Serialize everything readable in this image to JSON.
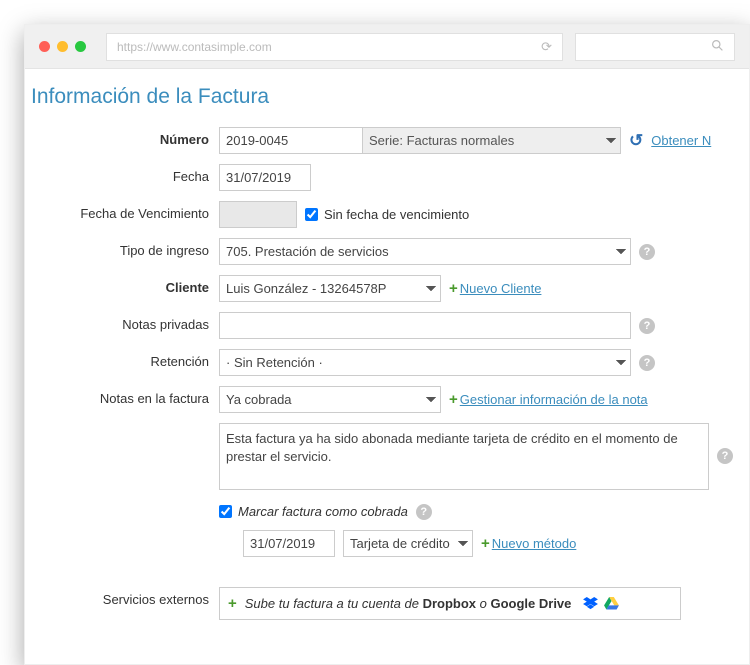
{
  "browser": {
    "url": "https://www.contasimple.com"
  },
  "title": "Información de la Factura",
  "labels": {
    "numero": "Número",
    "fecha": "Fecha",
    "fecha_venc": "Fecha de Vencimiento",
    "tipo_ingreso": "Tipo de ingreso",
    "cliente": "Cliente",
    "notas_priv": "Notas privadas",
    "retencion": "Retención",
    "notas_fact": "Notas en la factura",
    "serv_ext": "Servicios externos"
  },
  "numero": {
    "value": "2019-0045",
    "serie": "Serie: Facturas normales",
    "obtener": "Obtener N"
  },
  "fecha": {
    "value": "31/07/2019"
  },
  "fecha_venc": {
    "value": "",
    "sin_checked": true,
    "sin_label": "Sin fecha de vencimiento"
  },
  "tipo_ingreso": {
    "value": "705. Prestación de servicios"
  },
  "cliente": {
    "value": "Luis González - 13264578P",
    "nuevo": "Nuevo Cliente"
  },
  "notas_priv": {
    "value": ""
  },
  "retencion": {
    "value": "· Sin Retención ·"
  },
  "notas_fact": {
    "select": "Ya cobrada",
    "gestionar": "Gestionar información de la nota",
    "text": "Esta factura ya ha sido abonada mediante tarjeta de crédito en el momento de prestar el servicio."
  },
  "cobrada": {
    "label": "Marcar factura como cobrada",
    "checked": true,
    "fecha": "31/07/2019",
    "metodo": "Tarjeta de crédito",
    "nuevo_metodo": "Nuevo método"
  },
  "serv_ext": {
    "prefix": "Sube tu factura a tu cuenta de ",
    "dropbox": "Dropbox",
    "o": " o ",
    "gdrive": "Google Drive"
  }
}
